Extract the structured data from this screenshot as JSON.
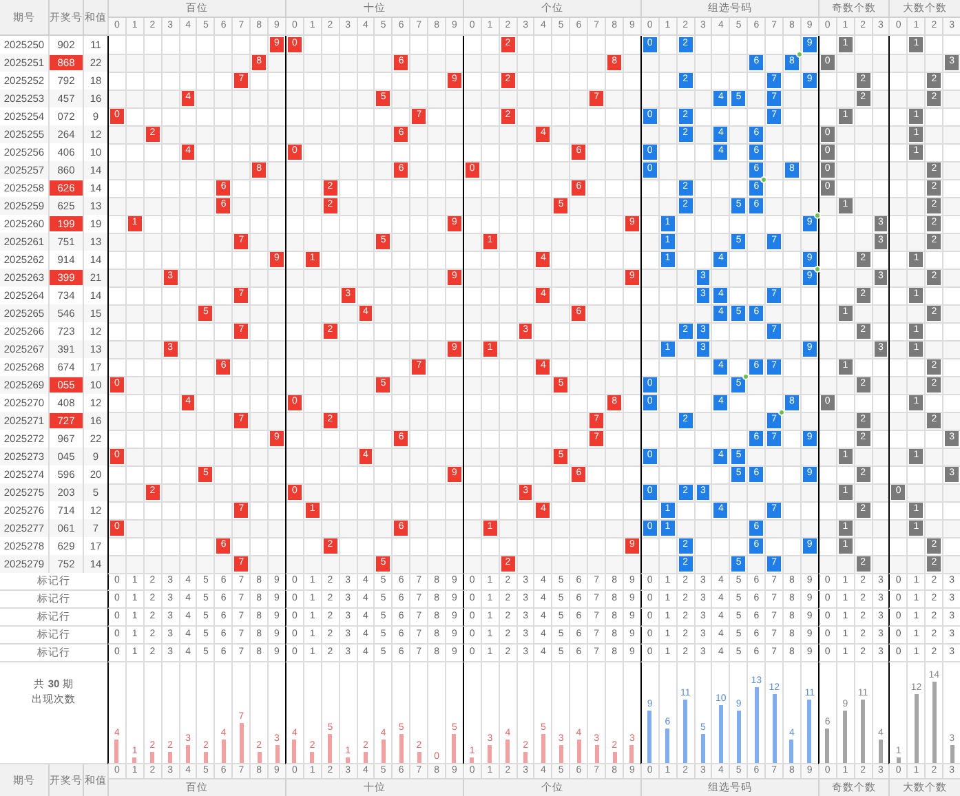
{
  "header": {
    "id": "期号",
    "number": "开奖号",
    "sum": "和值"
  },
  "groups": [
    {
      "name": "百位",
      "kind": "hundreds",
      "columns": [
        "0",
        "1",
        "2",
        "3",
        "4",
        "5",
        "6",
        "7",
        "8",
        "9"
      ],
      "counts": [
        "4",
        "1",
        "2",
        "2",
        "3",
        "2",
        "4",
        "7",
        "2",
        "3"
      ]
    },
    {
      "name": "十位",
      "kind": "tens",
      "columns": [
        "0",
        "1",
        "2",
        "3",
        "4",
        "5",
        "6",
        "7",
        "8",
        "9"
      ],
      "counts": [
        "4",
        "2",
        "5",
        "1",
        "2",
        "4",
        "5",
        "2",
        "0",
        "5"
      ]
    },
    {
      "name": "个位",
      "kind": "units",
      "columns": [
        "0",
        "1",
        "2",
        "3",
        "4",
        "5",
        "6",
        "7",
        "8",
        "9"
      ],
      "counts": [
        "1",
        "3",
        "4",
        "2",
        "5",
        "3",
        "4",
        "3",
        "2",
        "3"
      ]
    },
    {
      "name": "组选号码",
      "kind": "group",
      "columns": [
        "0",
        "1",
        "2",
        "3",
        "4",
        "5",
        "6",
        "7",
        "8",
        "9"
      ],
      "counts": [
        "9",
        "6",
        "11",
        "5",
        "10",
        "9",
        "13",
        "12",
        "4",
        "11"
      ]
    },
    {
      "name": "奇数个数",
      "kind": "odd",
      "columns": [
        "0",
        "1",
        "2",
        "3"
      ],
      "counts": [
        "6",
        "9",
        "11",
        "4"
      ]
    },
    {
      "name": "大数个数",
      "kind": "big",
      "columns": [
        "0",
        "1",
        "2",
        "3"
      ],
      "counts": [
        "1",
        "12",
        "14",
        "3"
      ]
    }
  ],
  "rows": [
    {
      "id": "2025250",
      "number": "902",
      "highlighted": false,
      "sum": "11",
      "hundreds": "9",
      "tens": "0",
      "units": "2",
      "group": [
        {
          "digit": "0",
          "repeat": false
        },
        {
          "digit": "2",
          "repeat": false
        },
        {
          "digit": "9",
          "repeat": false
        }
      ],
      "odd": "1",
      "big": "1"
    },
    {
      "id": "2025251",
      "number": "868",
      "highlighted": true,
      "sum": "22",
      "hundreds": "8",
      "tens": "6",
      "units": "8",
      "group": [
        {
          "digit": "6",
          "repeat": false
        },
        {
          "digit": "8",
          "repeat": true
        }
      ],
      "odd": "0",
      "big": "3"
    },
    {
      "id": "2025252",
      "number": "792",
      "highlighted": false,
      "sum": "18",
      "hundreds": "7",
      "tens": "9",
      "units": "2",
      "group": [
        {
          "digit": "2",
          "repeat": false
        },
        {
          "digit": "7",
          "repeat": false
        },
        {
          "digit": "9",
          "repeat": false
        }
      ],
      "odd": "2",
      "big": "2"
    },
    {
      "id": "2025253",
      "number": "457",
      "highlighted": false,
      "sum": "16",
      "hundreds": "4",
      "tens": "5",
      "units": "7",
      "group": [
        {
          "digit": "4",
          "repeat": false
        },
        {
          "digit": "5",
          "repeat": false
        },
        {
          "digit": "7",
          "repeat": false
        }
      ],
      "odd": "2",
      "big": "2"
    },
    {
      "id": "2025254",
      "number": "072",
      "highlighted": false,
      "sum": "9",
      "hundreds": "0",
      "tens": "7",
      "units": "2",
      "group": [
        {
          "digit": "0",
          "repeat": false
        },
        {
          "digit": "2",
          "repeat": false
        },
        {
          "digit": "7",
          "repeat": false
        }
      ],
      "odd": "1",
      "big": "1"
    },
    {
      "id": "2025255",
      "number": "264",
      "highlighted": false,
      "sum": "12",
      "hundreds": "2",
      "tens": "6",
      "units": "4",
      "group": [
        {
          "digit": "2",
          "repeat": false
        },
        {
          "digit": "4",
          "repeat": false
        },
        {
          "digit": "6",
          "repeat": false
        }
      ],
      "odd": "0",
      "big": "1"
    },
    {
      "id": "2025256",
      "number": "406",
      "highlighted": false,
      "sum": "10",
      "hundreds": "4",
      "tens": "0",
      "units": "6",
      "group": [
        {
          "digit": "0",
          "repeat": false
        },
        {
          "digit": "4",
          "repeat": false
        },
        {
          "digit": "6",
          "repeat": false
        }
      ],
      "odd": "0",
      "big": "1"
    },
    {
      "id": "2025257",
      "number": "860",
      "highlighted": false,
      "sum": "14",
      "hundreds": "8",
      "tens": "6",
      "units": "0",
      "group": [
        {
          "digit": "0",
          "repeat": false
        },
        {
          "digit": "6",
          "repeat": false
        },
        {
          "digit": "8",
          "repeat": false
        }
      ],
      "odd": "0",
      "big": "2"
    },
    {
      "id": "2025258",
      "number": "626",
      "highlighted": true,
      "sum": "14",
      "hundreds": "6",
      "tens": "2",
      "units": "6",
      "group": [
        {
          "digit": "2",
          "repeat": false
        },
        {
          "digit": "6",
          "repeat": true
        }
      ],
      "odd": "0",
      "big": "2"
    },
    {
      "id": "2025259",
      "number": "625",
      "highlighted": false,
      "sum": "13",
      "hundreds": "6",
      "tens": "2",
      "units": "5",
      "group": [
        {
          "digit": "2",
          "repeat": false
        },
        {
          "digit": "5",
          "repeat": false
        },
        {
          "digit": "6",
          "repeat": false
        }
      ],
      "odd": "1",
      "big": "2"
    },
    {
      "id": "2025260",
      "number": "199",
      "highlighted": true,
      "sum": "19",
      "hundreds": "1",
      "tens": "9",
      "units": "9",
      "group": [
        {
          "digit": "1",
          "repeat": false
        },
        {
          "digit": "9",
          "repeat": true
        }
      ],
      "odd": "3",
      "big": "2"
    },
    {
      "id": "2025261",
      "number": "751",
      "highlighted": false,
      "sum": "13",
      "hundreds": "7",
      "tens": "5",
      "units": "1",
      "group": [
        {
          "digit": "1",
          "repeat": false
        },
        {
          "digit": "5",
          "repeat": false
        },
        {
          "digit": "7",
          "repeat": false
        }
      ],
      "odd": "3",
      "big": "2"
    },
    {
      "id": "2025262",
      "number": "914",
      "highlighted": false,
      "sum": "14",
      "hundreds": "9",
      "tens": "1",
      "units": "4",
      "group": [
        {
          "digit": "1",
          "repeat": false
        },
        {
          "digit": "4",
          "repeat": false
        },
        {
          "digit": "9",
          "repeat": false
        }
      ],
      "odd": "2",
      "big": "1"
    },
    {
      "id": "2025263",
      "number": "399",
      "highlighted": true,
      "sum": "21",
      "hundreds": "3",
      "tens": "9",
      "units": "9",
      "group": [
        {
          "digit": "3",
          "repeat": false
        },
        {
          "digit": "9",
          "repeat": true
        }
      ],
      "odd": "3",
      "big": "2"
    },
    {
      "id": "2025264",
      "number": "734",
      "highlighted": false,
      "sum": "14",
      "hundreds": "7",
      "tens": "3",
      "units": "4",
      "group": [
        {
          "digit": "3",
          "repeat": false
        },
        {
          "digit": "4",
          "repeat": false
        },
        {
          "digit": "7",
          "repeat": false
        }
      ],
      "odd": "2",
      "big": "1"
    },
    {
      "id": "2025265",
      "number": "546",
      "highlighted": false,
      "sum": "15",
      "hundreds": "5",
      "tens": "4",
      "units": "6",
      "group": [
        {
          "digit": "4",
          "repeat": false
        },
        {
          "digit": "5",
          "repeat": false
        },
        {
          "digit": "6",
          "repeat": false
        }
      ],
      "odd": "1",
      "big": "2"
    },
    {
      "id": "2025266",
      "number": "723",
      "highlighted": false,
      "sum": "12",
      "hundreds": "7",
      "tens": "2",
      "units": "3",
      "group": [
        {
          "digit": "2",
          "repeat": false
        },
        {
          "digit": "3",
          "repeat": false
        },
        {
          "digit": "7",
          "repeat": false
        }
      ],
      "odd": "2",
      "big": "1"
    },
    {
      "id": "2025267",
      "number": "391",
      "highlighted": false,
      "sum": "13",
      "hundreds": "3",
      "tens": "9",
      "units": "1",
      "group": [
        {
          "digit": "1",
          "repeat": false
        },
        {
          "digit": "3",
          "repeat": false
        },
        {
          "digit": "9",
          "repeat": false
        }
      ],
      "odd": "3",
      "big": "1"
    },
    {
      "id": "2025268",
      "number": "674",
      "highlighted": false,
      "sum": "17",
      "hundreds": "6",
      "tens": "7",
      "units": "4",
      "group": [
        {
          "digit": "4",
          "repeat": false
        },
        {
          "digit": "6",
          "repeat": false
        },
        {
          "digit": "7",
          "repeat": false
        }
      ],
      "odd": "1",
      "big": "2"
    },
    {
      "id": "2025269",
      "number": "055",
      "highlighted": true,
      "sum": "10",
      "hundreds": "0",
      "tens": "5",
      "units": "5",
      "group": [
        {
          "digit": "0",
          "repeat": false
        },
        {
          "digit": "5",
          "repeat": true
        }
      ],
      "odd": "2",
      "big": "2"
    },
    {
      "id": "2025270",
      "number": "408",
      "highlighted": false,
      "sum": "12",
      "hundreds": "4",
      "tens": "0",
      "units": "8",
      "group": [
        {
          "digit": "0",
          "repeat": false
        },
        {
          "digit": "4",
          "repeat": false
        },
        {
          "digit": "8",
          "repeat": false
        }
      ],
      "odd": "0",
      "big": "1"
    },
    {
      "id": "2025271",
      "number": "727",
      "highlighted": true,
      "sum": "16",
      "hundreds": "7",
      "tens": "2",
      "units": "7",
      "group": [
        {
          "digit": "2",
          "repeat": false
        },
        {
          "digit": "7",
          "repeat": true
        }
      ],
      "odd": "2",
      "big": "2"
    },
    {
      "id": "2025272",
      "number": "967",
      "highlighted": false,
      "sum": "22",
      "hundreds": "9",
      "tens": "6",
      "units": "7",
      "group": [
        {
          "digit": "6",
          "repeat": false
        },
        {
          "digit": "7",
          "repeat": false
        },
        {
          "digit": "9",
          "repeat": false
        }
      ],
      "odd": "2",
      "big": "3"
    },
    {
      "id": "2025273",
      "number": "045",
      "highlighted": false,
      "sum": "9",
      "hundreds": "0",
      "tens": "4",
      "units": "5",
      "group": [
        {
          "digit": "0",
          "repeat": false
        },
        {
          "digit": "4",
          "repeat": false
        },
        {
          "digit": "5",
          "repeat": false
        }
      ],
      "odd": "1",
      "big": "1"
    },
    {
      "id": "2025274",
      "number": "596",
      "highlighted": false,
      "sum": "20",
      "hundreds": "5",
      "tens": "9",
      "units": "6",
      "group": [
        {
          "digit": "5",
          "repeat": false
        },
        {
          "digit": "6",
          "repeat": false
        },
        {
          "digit": "9",
          "repeat": false
        }
      ],
      "odd": "2",
      "big": "3"
    },
    {
      "id": "2025275",
      "number": "203",
      "highlighted": false,
      "sum": "5",
      "hundreds": "2",
      "tens": "0",
      "units": "3",
      "group": [
        {
          "digit": "0",
          "repeat": false
        },
        {
          "digit": "2",
          "repeat": false
        },
        {
          "digit": "3",
          "repeat": false
        }
      ],
      "odd": "1",
      "big": "0"
    },
    {
      "id": "2025276",
      "number": "714",
      "highlighted": false,
      "sum": "12",
      "hundreds": "7",
      "tens": "1",
      "units": "4",
      "group": [
        {
          "digit": "1",
          "repeat": false
        },
        {
          "digit": "4",
          "repeat": false
        },
        {
          "digit": "7",
          "repeat": false
        }
      ],
      "odd": "2",
      "big": "1"
    },
    {
      "id": "2025277",
      "number": "061",
      "highlighted": false,
      "sum": "7",
      "hundreds": "0",
      "tens": "6",
      "units": "1",
      "group": [
        {
          "digit": "0",
          "repeat": false
        },
        {
          "digit": "1",
          "repeat": false
        },
        {
          "digit": "6",
          "repeat": false
        }
      ],
      "odd": "1",
      "big": "1"
    },
    {
      "id": "2025278",
      "number": "629",
      "highlighted": false,
      "sum": "17",
      "hundreds": "6",
      "tens": "2",
      "units": "9",
      "group": [
        {
          "digit": "2",
          "repeat": false
        },
        {
          "digit": "6",
          "repeat": false
        },
        {
          "digit": "9",
          "repeat": false
        }
      ],
      "odd": "1",
      "big": "2"
    },
    {
      "id": "2025279",
      "number": "752",
      "highlighted": false,
      "sum": "14",
      "hundreds": "7",
      "tens": "5",
      "units": "2",
      "group": [
        {
          "digit": "2",
          "repeat": false
        },
        {
          "digit": "5",
          "repeat": false
        },
        {
          "digit": "7",
          "repeat": false
        }
      ],
      "odd": "2",
      "big": "2"
    }
  ],
  "marker_rows": [
    {
      "label": "标记行",
      "digits": [
        [
          "0",
          "1",
          "2",
          "3",
          "4",
          "5",
          "6",
          "7",
          "8",
          "9"
        ],
        [
          "0",
          "1",
          "2",
          "3",
          "4",
          "5",
          "6",
          "7",
          "8",
          "9"
        ],
        [
          "0",
          "1",
          "2",
          "3",
          "4",
          "5",
          "6",
          "7",
          "8",
          "9"
        ],
        [
          "0",
          "1",
          "2",
          "3",
          "4",
          "5",
          "6",
          "7",
          "8",
          "9"
        ],
        [
          "0",
          "1",
          "2",
          "3"
        ],
        [
          "0",
          "1",
          "2",
          "3"
        ]
      ]
    },
    {
      "label": "标记行",
      "digits": [
        [
          "0",
          "1",
          "2",
          "3",
          "4",
          "5",
          "6",
          "7",
          "8",
          "9"
        ],
        [
          "0",
          "1",
          "2",
          "3",
          "4",
          "5",
          "6",
          "7",
          "8",
          "9"
        ],
        [
          "0",
          "1",
          "2",
          "3",
          "4",
          "5",
          "6",
          "7",
          "8",
          "9"
        ],
        [
          "0",
          "1",
          "2",
          "3",
          "4",
          "5",
          "6",
          "7",
          "8",
          "9"
        ],
        [
          "0",
          "1",
          "2",
          "3"
        ],
        [
          "0",
          "1",
          "2",
          "3"
        ]
      ]
    },
    {
      "label": "标记行",
      "digits": [
        [
          "0",
          "1",
          "2",
          "3",
          "4",
          "5",
          "6",
          "7",
          "8",
          "9"
        ],
        [
          "0",
          "1",
          "2",
          "3",
          "4",
          "5",
          "6",
          "7",
          "8",
          "9"
        ],
        [
          "0",
          "1",
          "2",
          "3",
          "4",
          "5",
          "6",
          "7",
          "8",
          "9"
        ],
        [
          "0",
          "1",
          "2",
          "3",
          "4",
          "5",
          "6",
          "7",
          "8",
          "9"
        ],
        [
          "0",
          "1",
          "2",
          "3"
        ],
        [
          "0",
          "1",
          "2",
          "3"
        ]
      ]
    },
    {
      "label": "标记行",
      "digits": [
        [
          "0",
          "1",
          "2",
          "3",
          "4",
          "5",
          "6",
          "7",
          "8",
          "9"
        ],
        [
          "0",
          "1",
          "2",
          "3",
          "4",
          "5",
          "6",
          "7",
          "8",
          "9"
        ],
        [
          "0",
          "1",
          "2",
          "3",
          "4",
          "5",
          "6",
          "7",
          "8",
          "9"
        ],
        [
          "0",
          "1",
          "2",
          "3",
          "4",
          "5",
          "6",
          "7",
          "8",
          "9"
        ],
        [
          "0",
          "1",
          "2",
          "3"
        ],
        [
          "0",
          "1",
          "2",
          "3"
        ]
      ]
    },
    {
      "label": "标记行",
      "digits": [
        [
          "0",
          "1",
          "2",
          "3",
          "4",
          "5",
          "6",
          "7",
          "8",
          "9"
        ],
        [
          "0",
          "1",
          "2",
          "3",
          "4",
          "5",
          "6",
          "7",
          "8",
          "9"
        ],
        [
          "0",
          "1",
          "2",
          "3",
          "4",
          "5",
          "6",
          "7",
          "8",
          "9"
        ],
        [
          "0",
          "1",
          "2",
          "3",
          "4",
          "5",
          "6",
          "7",
          "8",
          "9"
        ],
        [
          "0",
          "1",
          "2",
          "3"
        ],
        [
          "0",
          "1",
          "2",
          "3"
        ]
      ]
    }
  ],
  "summary": {
    "line_1": "共 **30** 期",
    "line_2": "出现次数"
  },
  "footer": {
    "id": "期号",
    "number": "开奖号",
    "sum": "和值",
    "groups": [
      {
        "name": "百位",
        "columns": [
          "0",
          "1",
          "2",
          "3",
          "4",
          "5",
          "6",
          "7",
          "8",
          "9"
        ]
      },
      {
        "name": "十位",
        "columns": [
          "0",
          "1",
          "2",
          "3",
          "4",
          "5",
          "6",
          "7",
          "8",
          "9"
        ]
      },
      {
        "name": "个位",
        "columns": [
          "0",
          "1",
          "2",
          "3",
          "4",
          "5",
          "6",
          "7",
          "8",
          "9"
        ]
      },
      {
        "name": "组选号码",
        "columns": [
          "0",
          "1",
          "2",
          "3",
          "4",
          "5",
          "6",
          "7",
          "8",
          "9"
        ]
      },
      {
        "name": "奇数个数",
        "columns": [
          "0",
          "1",
          "2",
          "3"
        ]
      },
      {
        "name": "大数个数",
        "columns": [
          "0",
          "1",
          "2",
          "3"
        ]
      }
    ]
  }
}
